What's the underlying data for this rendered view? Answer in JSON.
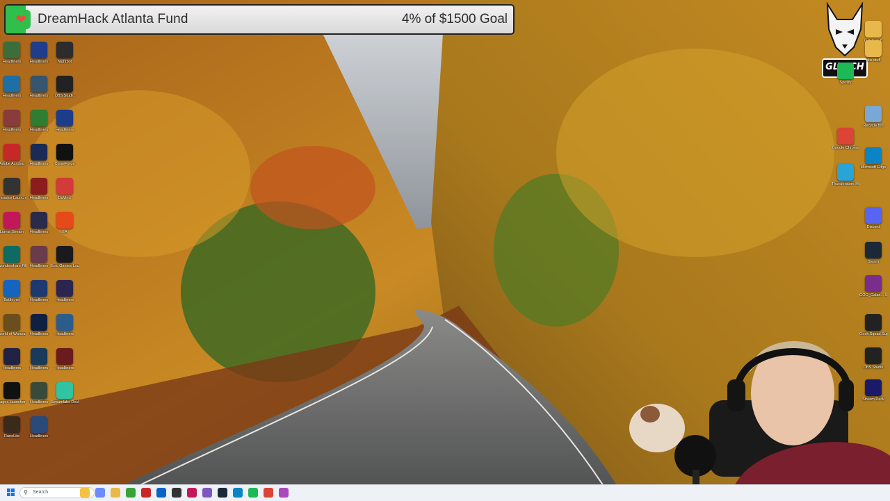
{
  "fund": {
    "title": "DreamHack Atlanta Fund",
    "goal_text": "4% of $1500 Goal",
    "progress_percent": 4,
    "icon": "heart-icon",
    "accent": "#2fbf4a"
  },
  "overlay_logo": {
    "text": "GLYTCH"
  },
  "desktop_icons_left": [
    {
      "label": "Headliners",
      "color": "#3b6e3a"
    },
    {
      "label": "Headliners",
      "color": "#1f3d8a"
    },
    {
      "label": "Nightbot",
      "color": "#2c2c2c"
    },
    {
      "label": "Headliners",
      "color": "#1d6fa5"
    },
    {
      "label": "Headliners",
      "color": "#35566e"
    },
    {
      "label": "OBS Studio",
      "color": "#222222"
    },
    {
      "label": "Headliners",
      "color": "#8a3b3b"
    },
    {
      "label": "Headliners",
      "color": "#2e7d32"
    },
    {
      "label": "Headliners",
      "color": "#1d3c8a"
    },
    {
      "label": "Adobe Acrobat",
      "color": "#c62828"
    },
    {
      "label": "Headliners",
      "color": "#1b2b55"
    },
    {
      "label": "CurseForge",
      "color": "#111111"
    },
    {
      "label": "Paradox Launcher v2",
      "color": "#333333"
    },
    {
      "label": "Headliners",
      "color": "#8b1d1d"
    },
    {
      "label": "DaVinci",
      "color": "#d33a3a"
    },
    {
      "label": "Lumia Stream",
      "color": "#c2185b"
    },
    {
      "label": "Headliners",
      "color": "#2a2a4a"
    },
    {
      "label": "EA",
      "color": "#e64a19"
    },
    {
      "label": "Wondershare Filmora 14",
      "color": "#0e6b63"
    },
    {
      "label": "Headliners",
      "color": "#6a3b4a"
    },
    {
      "label": "Epic Games Launcher",
      "color": "#1a1a1a"
    },
    {
      "label": "Battle.net",
      "color": "#1565c0"
    },
    {
      "label": "Headliners",
      "color": "#1d3a70"
    },
    {
      "label": "Headliners",
      "color": "#2b2550"
    },
    {
      "label": "World of Warcraft",
      "color": "#6b4e1e"
    },
    {
      "label": "Headliners",
      "color": "#102040"
    },
    {
      "label": "Headliners",
      "color": "#2c5d8a"
    },
    {
      "label": "Headliners",
      "color": "#222244"
    },
    {
      "label": "Headliners",
      "color": "#1a3a5a"
    },
    {
      "label": "Headliners",
      "color": "#6a1b1b"
    },
    {
      "label": "Jagex Launcher",
      "color": "#111111"
    },
    {
      "label": "Headliners",
      "color": "#3a4a3a"
    },
    {
      "label": "Streamlabs Desktop",
      "color": "#31c3a2"
    },
    {
      "label": "RuneLite",
      "color": "#3a2a1a"
    },
    {
      "label": "Headliners",
      "color": "#2a4a7a"
    }
  ],
  "desktop_icons_right": [
    {
      "label": "twitch stuff",
      "color": "#e8b84a"
    },
    {
      "label": "obs stuff",
      "color": "#e8b84a"
    },
    {
      "label": "Spotify",
      "color": "#1db954"
    },
    {
      "label": "Recycle Bin",
      "color": "#7aa7d6"
    },
    {
      "label": "Google Chrome",
      "color": "#db4437"
    },
    {
      "label": "Microsoft Edge",
      "color": "#0a84c6"
    },
    {
      "label": "Thunderstore Mod Mana...",
      "color": "#2aa3d6"
    },
    {
      "label": "Discord",
      "color": "#5865f2"
    },
    {
      "label": "Steam",
      "color": "#1b2838"
    },
    {
      "label": "GOG_Galax... Shortcut",
      "color": "#7b2d8e"
    },
    {
      "label": "Geek Squad Support.exe",
      "color": "#222222"
    },
    {
      "label": "OBS Studio",
      "color": "#222222"
    },
    {
      "label": "Stream Deck",
      "color": "#1a1a6a"
    }
  ],
  "taskbar": {
    "search_placeholder": "Search",
    "apps": [
      {
        "name": "file-explorer-icon",
        "color": "#f5c242"
      },
      {
        "name": "copilot-icon",
        "color": "#6a8cff"
      },
      {
        "name": "folder-icon",
        "color": "#e8b84a"
      },
      {
        "name": "xbox-icon",
        "color": "#3aa23a"
      },
      {
        "name": "adobe-icon",
        "color": "#c62828"
      },
      {
        "name": "outlook-icon",
        "color": "#0a64c6"
      },
      {
        "name": "obs-icon",
        "color": "#333333"
      },
      {
        "name": "davinci-icon",
        "color": "#c2185b"
      },
      {
        "name": "lumia-icon",
        "color": "#7e57c2"
      },
      {
        "name": "steam-icon",
        "color": "#1b2838"
      },
      {
        "name": "edge-icon",
        "color": "#0a84c6"
      },
      {
        "name": "spotify-icon",
        "color": "#1db954"
      },
      {
        "name": "chrome-icon",
        "color": "#db4437"
      },
      {
        "name": "streamlabs-icon",
        "color": "#ab47bc"
      }
    ]
  }
}
